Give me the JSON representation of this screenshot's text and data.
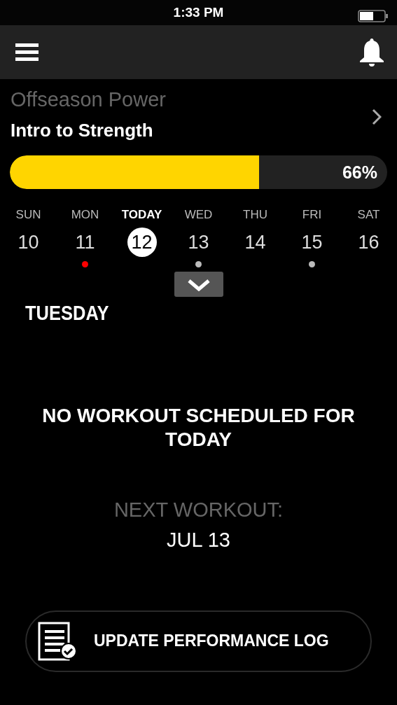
{
  "status_bar": {
    "time": "1:33 PM"
  },
  "program": {
    "name": "Offseason Power",
    "phase": "Intro to Strength",
    "progress": {
      "level": 0.66,
      "reading": "66%"
    }
  },
  "week": [
    {
      "day": "SUN",
      "date": "10",
      "selected": false
    },
    {
      "day": "MON",
      "date": "11",
      "selected": false,
      "color": "#ff0000"
    },
    {
      "day": "TODAY",
      "date": "12",
      "selected": true
    },
    {
      "day": "WED",
      "date": "13",
      "selected": false,
      "color": "#bbbbbb"
    },
    {
      "day": "THU",
      "date": "14",
      "selected": false
    },
    {
      "day": "FRI",
      "date": "15",
      "selected": false,
      "color": "#bbbbbb"
    },
    {
      "day": "SAT",
      "date": "16",
      "selected": false
    }
  ],
  "day_title": "TUESDAY",
  "message": "NO WORKOUT SCHEDULED FOR TODAY",
  "next_workout": {
    "label": "NEXT WORKOUT:",
    "date": "JUL 13"
  },
  "action_button": "UPDATE PERFORMANCE LOG"
}
